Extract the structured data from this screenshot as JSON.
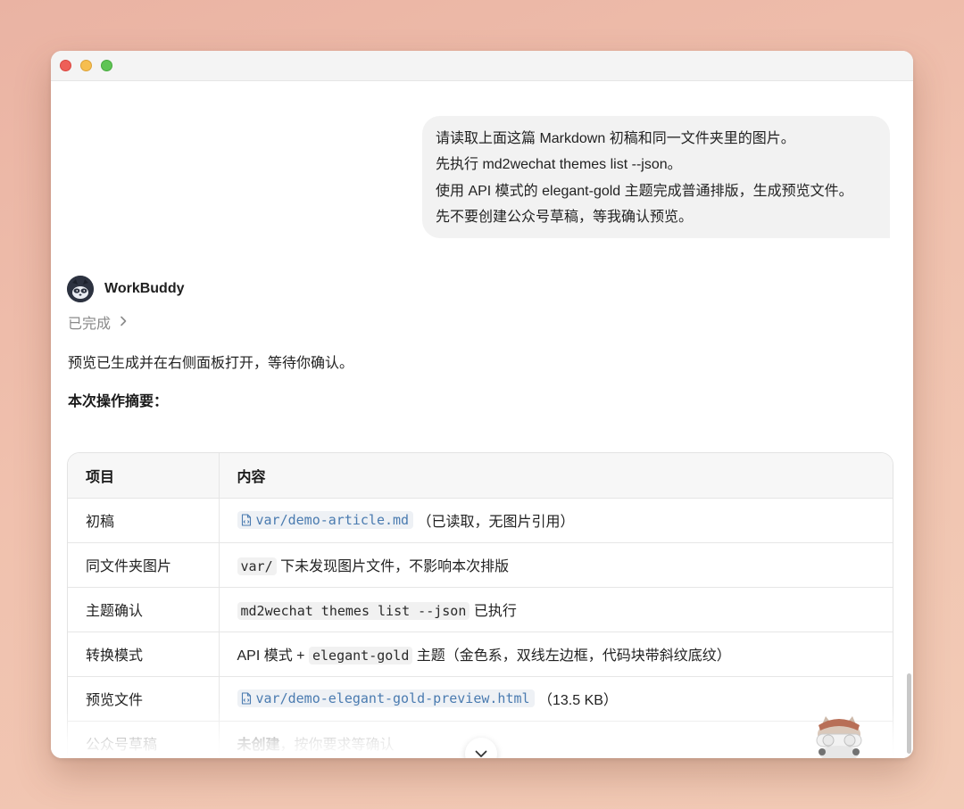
{
  "window": {
    "traffic_lights": [
      "close-button",
      "minimize-button",
      "zoom-button"
    ]
  },
  "user_message": {
    "lines": [
      "请读取上面这篇 Markdown 初稿和同一文件夹里的图片。",
      "先执行 md2wechat themes list --json。",
      "使用 API 模式的 elegant-gold 主题完成普通排版，生成预览文件。",
      "先不要创建公众号草稿，等我确认预览。"
    ]
  },
  "assistant": {
    "name": "WorkBuddy",
    "status": "已完成",
    "intro": "预览已生成并在右侧面板打开，等待你确认。",
    "summary_heading": "本次操作摘要："
  },
  "table": {
    "headers": [
      "项目",
      "内容"
    ],
    "rows": [
      {
        "item": "初稿",
        "file": "var/demo-article.md",
        "text": "（已读取，无图片引用）"
      },
      {
        "item": "同文件夹图片",
        "code": "var/",
        "text": " 下未发现图片文件，不影响本次排版"
      },
      {
        "item": "主题确认",
        "code": "md2wechat themes list --json",
        "text": " 已执行"
      },
      {
        "item": "转换模式",
        "prefix": "API 模式 + ",
        "code": "elegant-gold",
        "text": " 主题（金色系，双线左边框，代码块带斜纹底纹）"
      },
      {
        "item": "预览文件",
        "file": "var/demo-elegant-gold-preview.html",
        "text": "（13.5 KB）"
      },
      {
        "item": "公众号草稿",
        "bold": "未创建",
        "text": "，按你要求等确认"
      }
    ]
  },
  "colors": {
    "background": "#eab3a3",
    "link": "#4a7bb0",
    "bubble": "#f2f2f2"
  }
}
